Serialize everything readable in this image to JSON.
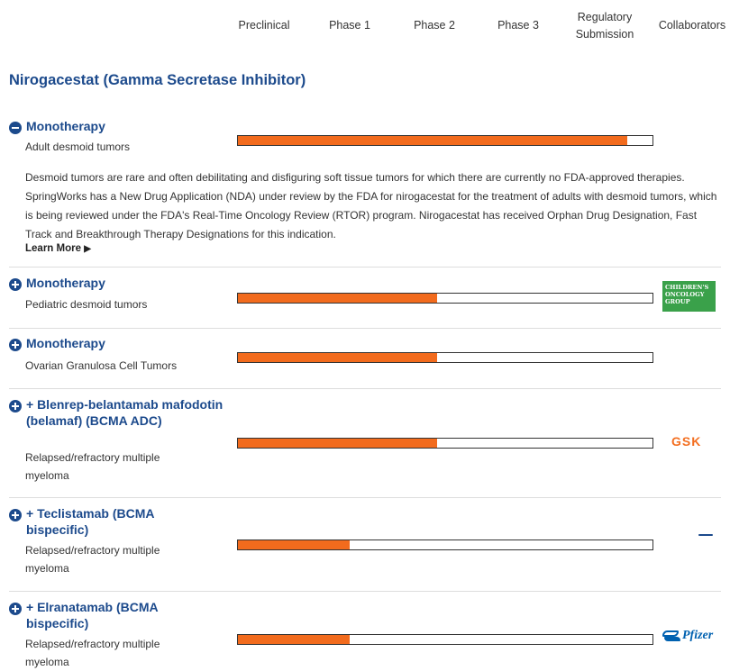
{
  "phases": [
    "Preclinical",
    "Phase 1",
    "Phase 2",
    "Phase 3",
    "Regulatory Submission",
    "Collaborators"
  ],
  "drug": {
    "title": "Nirogacestat (Gamma Secretase Inhibitor)"
  },
  "programs": [
    {
      "title": "Monotherapy",
      "indication": "Adult desmoid tumors",
      "expanded": true,
      "progress": 0.94,
      "description": "Desmoid tumors are rare and often debilitating and disfiguring soft tissue tumors for which there are currently no FDA-approved therapies. SpringWorks has a New Drug Application (NDA) under review by the FDA for nirogacestat for the treatment of adults with desmoid tumors, which is being reviewed under the FDA's Real-Time Oncology Review (RTOR) program. Nirogacestat has received Orphan Drug Designation, Fast Track and Breakthrough Therapy Designations for this indication.",
      "learn_more": "Learn More"
    },
    {
      "title": "Monotherapy",
      "indication": "Pediatric desmoid tumors",
      "progress": 0.48,
      "collaborator": [
        "CHILDREN'S",
        "ONCOLOGY",
        "GROUP"
      ]
    },
    {
      "title": "Monotherapy",
      "indication": "Ovarian Granulosa Cell Tumors",
      "progress": 0.48
    },
    {
      "title": "+ Blenrep-belantamab mafodotin (belamaf) (BCMA ADC)",
      "indication": "Relapsed/refractory multiple myeloma",
      "progress": 0.48,
      "collaborator": "GSK"
    },
    {
      "title": "+ Teclistamab (BCMA bispecific)",
      "indication": "Relapsed/refractory multiple myeloma",
      "progress": 0.27
    },
    {
      "title": "+ Elranatamab (BCMA bispecific)",
      "indication": "Relapsed/refractory multiple myeloma",
      "progress": 0.27,
      "collaborator": "Pfizer"
    }
  ],
  "colors": {
    "accent": "#1c4a8c",
    "progress": "#f26b1d",
    "cog": "#3aa14a",
    "gsk": "#f36f21",
    "pfizer": "#0061b0"
  }
}
